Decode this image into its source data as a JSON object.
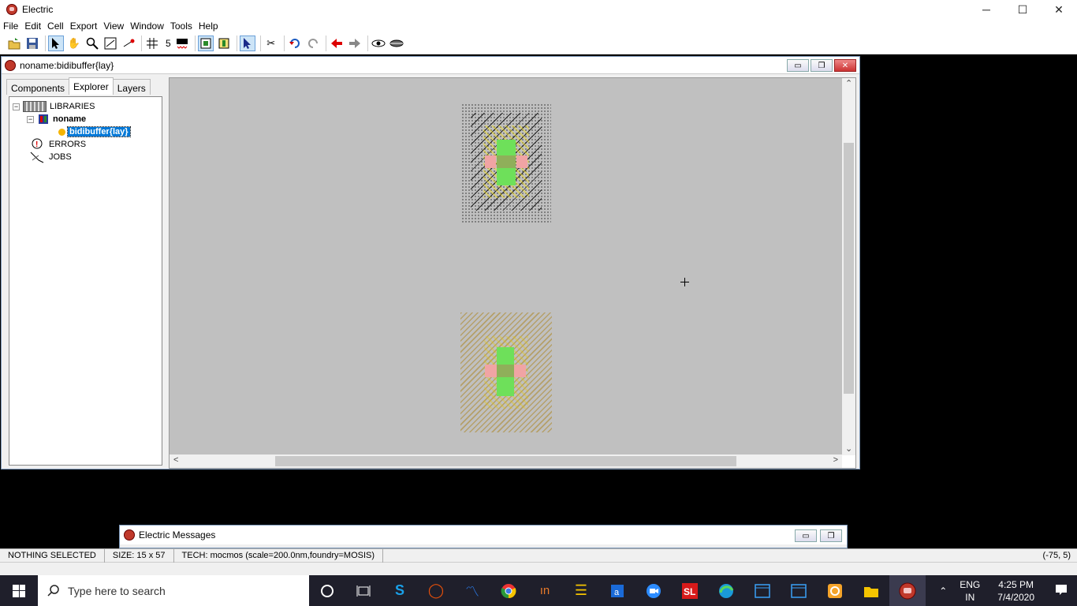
{
  "app": {
    "title": "Electric"
  },
  "window_controls": {
    "minimize": "─",
    "maximize": "☐",
    "close": "✕"
  },
  "menu": [
    "File",
    "Edit",
    "Cell",
    "Export",
    "View",
    "Window",
    "Tools",
    "Help"
  ],
  "toolbar": {
    "grid_size": "5",
    "icons": [
      "open-icon",
      "save-icon",
      "select-arrow-icon",
      "pan-hand-icon",
      "zoom-icon",
      "outline-edit-icon",
      "measure-icon",
      "grid-icon",
      "align-icon",
      "arc-icon",
      "cursor-select-icon",
      "cut-wires-icon",
      "undo-icon",
      "redo-icon",
      "back-arrow-icon",
      "forward-arrow-icon",
      "eye-icon",
      "eye-closed-icon"
    ]
  },
  "document": {
    "title": "noname:bidibuffer{lay}",
    "controls": {
      "minimize": "▭",
      "restore": "❐",
      "close": "✕"
    }
  },
  "sidebar": {
    "tabs": [
      {
        "label": "Components"
      },
      {
        "label": "Explorer"
      },
      {
        "label": "Layers"
      }
    ],
    "tree": {
      "libraries": "LIBRARIES",
      "library": "noname",
      "cell": "bidibuffer{lay}",
      "errors": "ERRORS",
      "jobs": "JOBS"
    }
  },
  "canvas": {
    "scroll_up": "⌃",
    "scroll_down": "⌄",
    "scroll_left": "<",
    "scroll_right": ">"
  },
  "messages": {
    "title": "Electric Messages",
    "controls": {
      "minimize": "▭",
      "restore": "❐"
    }
  },
  "status": {
    "selection": "NOTHING SELECTED",
    "size": "SIZE: 15 x 57",
    "tech": "TECH: mocmos (scale=200.0nm,foundry=MOSIS)",
    "coords": "(-75, 5)"
  },
  "taskbar": {
    "search_placeholder": "Type here to search",
    "apps": [
      "cortana-icon",
      "task-view-icon",
      "skype-icon",
      "office-icon",
      "matlab-icon",
      "chrome-icon",
      "invision-icon",
      "sticky-notes-icon",
      "java-icon",
      "zoom-icon",
      "sl-icon",
      "edge-icon",
      "window-icon",
      "window-icon-2",
      "qbittorrent-icon",
      "file-explorer-icon",
      "electric-icon"
    ],
    "language": "ENG",
    "region": "IN",
    "time": "4:25 PM",
    "date": "7/4/2020"
  }
}
